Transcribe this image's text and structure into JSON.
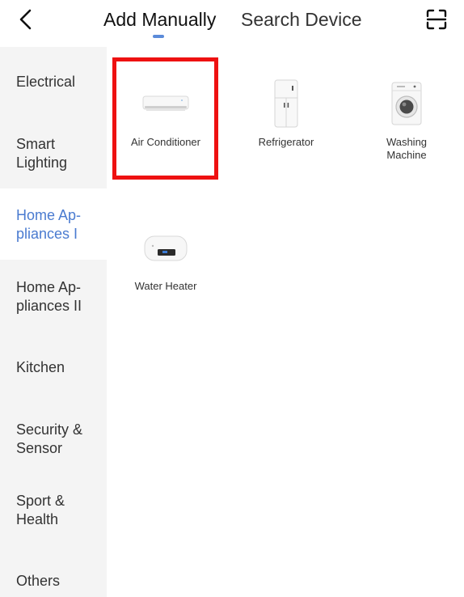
{
  "header": {
    "back_icon": "chevron-left-icon",
    "tabs": [
      {
        "label": "Add Manually",
        "active": true
      },
      {
        "label": "Search Device",
        "active": false
      }
    ],
    "scan_icon": "scan-icon",
    "accent_color": "#5b8bd9"
  },
  "sidebar": {
    "active_color": "#4a7bd0",
    "items": [
      {
        "label": "Electrical"
      },
      {
        "label": "Smart\nLighting"
      },
      {
        "label": "Home Ap-\npliances I",
        "active": true
      },
      {
        "label": "Home Ap-\npliances II"
      },
      {
        "label": "Kitchen"
      },
      {
        "label": "Security &\nSensor"
      },
      {
        "label": "Sport &\nHealth"
      },
      {
        "label": "Others"
      }
    ]
  },
  "devices": [
    {
      "label": "Air Conditioner",
      "icon": "air-conditioner-icon",
      "highlighted": true
    },
    {
      "label": "Refrigerator",
      "icon": "refrigerator-icon"
    },
    {
      "label": "Washing\nMachine",
      "icon": "washing-machine-icon"
    },
    {
      "label": "Water Heater",
      "icon": "water-heater-icon"
    }
  ],
  "highlight_color": "#ee1111"
}
